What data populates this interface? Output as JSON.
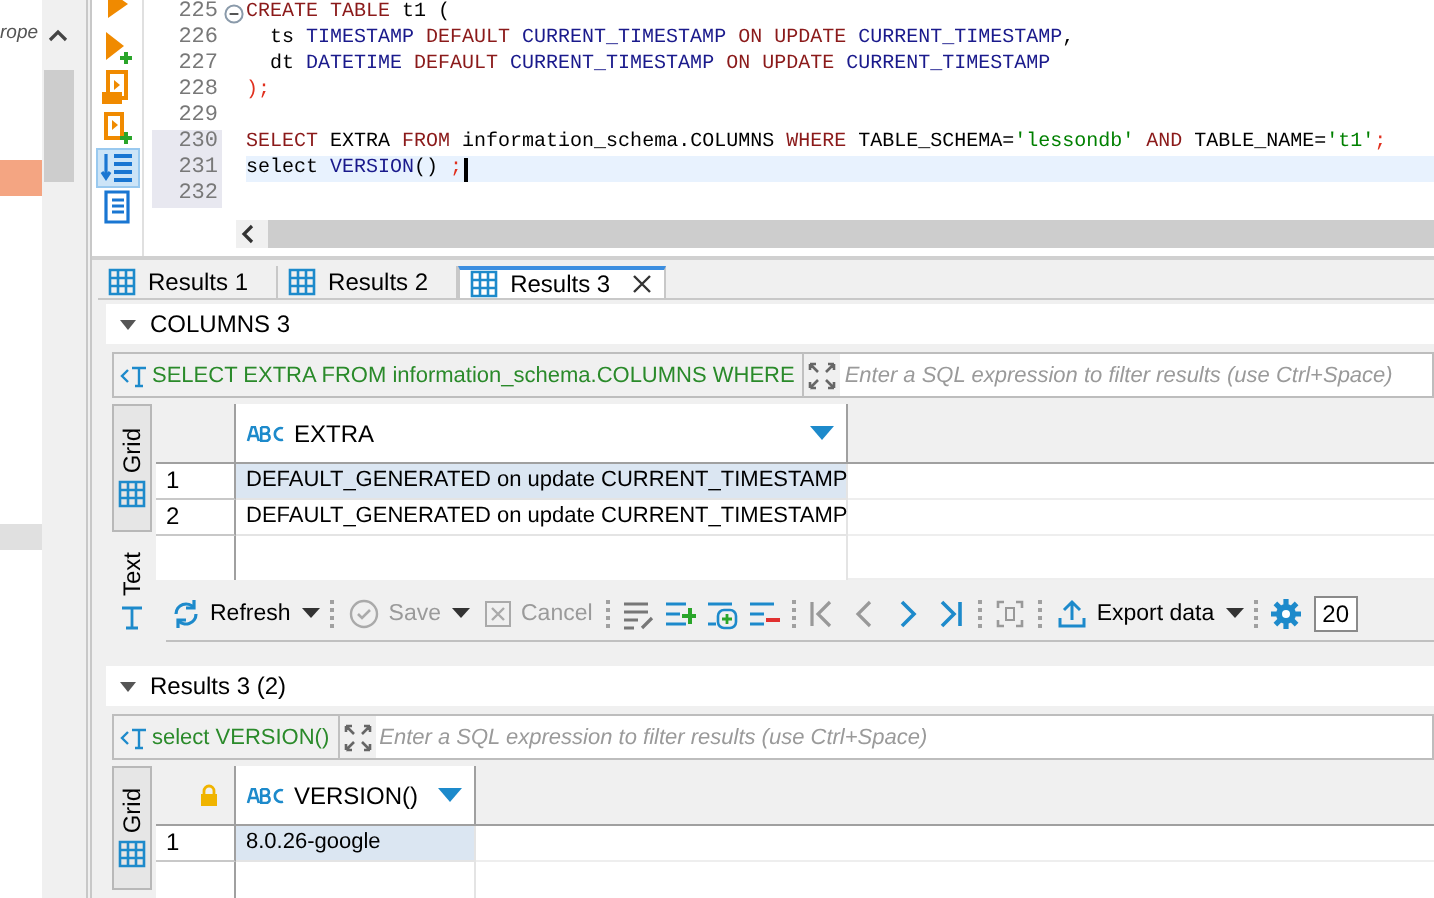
{
  "left_panel": {
    "label": "rope"
  },
  "editor": {
    "tools": [
      {
        "selected": false
      },
      {
        "selected": false
      },
      {
        "selected": false
      },
      {
        "selected": false
      },
      {
        "selected": true
      },
      {
        "selected": false
      }
    ],
    "lines": [
      {
        "number": "225",
        "collapsible": true,
        "marked": false,
        "current": false,
        "tokens": [
          {
            "kind": "keyword",
            "text": "CREATE TABLE"
          },
          {
            "kind": "plain",
            "text": " t1 ("
          }
        ]
      },
      {
        "number": "226",
        "collapsible": false,
        "marked": false,
        "current": false,
        "tokens": [
          {
            "kind": "plain",
            "text": "  ts "
          },
          {
            "kind": "type",
            "text": "TIMESTAMP "
          },
          {
            "kind": "keyword",
            "text": "DEFAULT "
          },
          {
            "kind": "type",
            "text": "CURRENT_TIMESTAMP "
          },
          {
            "kind": "keyword",
            "text": "ON UPDATE "
          },
          {
            "kind": "type",
            "text": "CURRENT_TIMESTAMP"
          },
          {
            "kind": "plain",
            "text": ","
          }
        ]
      },
      {
        "number": "227",
        "collapsible": false,
        "marked": false,
        "current": false,
        "tokens": [
          {
            "kind": "plain",
            "text": "  dt "
          },
          {
            "kind": "type",
            "text": "DATETIME "
          },
          {
            "kind": "keyword",
            "text": "DEFAULT "
          },
          {
            "kind": "type",
            "text": "CURRENT_TIMESTAMP "
          },
          {
            "kind": "keyword",
            "text": "ON UPDATE "
          },
          {
            "kind": "type",
            "text": "CURRENT_TIMESTAMP"
          }
        ]
      },
      {
        "number": "228",
        "collapsible": false,
        "marked": false,
        "current": false,
        "tokens": [
          {
            "kind": "punct",
            "text": ");"
          }
        ]
      },
      {
        "number": "229",
        "collapsible": false,
        "marked": false,
        "current": false
      },
      {
        "number": "230",
        "collapsible": false,
        "marked": true,
        "current": false,
        "tokens": [
          {
            "kind": "keyword",
            "text": "SELECT"
          },
          {
            "kind": "plain",
            "text": " EXTRA "
          },
          {
            "kind": "keyword",
            "text": "FROM"
          },
          {
            "kind": "plain",
            "text": " information_schema.COLUMNS "
          },
          {
            "kind": "keyword",
            "text": "WHERE"
          },
          {
            "kind": "plain",
            "text": " TABLE_SCHEMA="
          },
          {
            "kind": "string",
            "text": "'lessondb' "
          },
          {
            "kind": "keyword",
            "text": "AND"
          },
          {
            "kind": "plain",
            "text": " TABLE_NAME="
          },
          {
            "kind": "string",
            "text": "'t1'"
          },
          {
            "kind": "punct",
            "text": ";"
          }
        ]
      },
      {
        "number": "231",
        "collapsible": false,
        "marked": true,
        "current": true,
        "tokens": [
          {
            "kind": "plain",
            "text": "select "
          },
          {
            "kind": "type",
            "text": "VERSION"
          },
          {
            "kind": "plain",
            "text": "() "
          },
          {
            "kind": "punct",
            "text": ";"
          }
        ]
      },
      {
        "number": "232",
        "collapsible": false,
        "marked": true,
        "current": false
      }
    ]
  },
  "result_tabs": [
    {
      "label": "Results 1",
      "selected": false,
      "closable": false
    },
    {
      "label": "Results 2",
      "selected": false,
      "closable": false
    },
    {
      "label": "Results 3",
      "selected": true,
      "closable": true
    }
  ],
  "results": [
    {
      "title": "COLUMNS 3",
      "expanded": true,
      "query": "SELECT EXTRA FROM information_schema.COLUMNS WHERE",
      "filter_placeholder": "Enter a SQL expression to filter results (use Ctrl+Space)",
      "views": [
        {
          "label": "Grid",
          "selected": true
        },
        {
          "label": "Text",
          "selected": false
        }
      ],
      "locked": false,
      "columns": [
        "EXTRA"
      ],
      "rows": [
        {
          "number": "1",
          "cells": [
            "DEFAULT_GENERATED on update CURRENT_TIMESTAMP"
          ],
          "selected": true
        },
        {
          "number": "2",
          "cells": [
            "DEFAULT_GENERATED on update CURRENT_TIMESTAMP"
          ],
          "selected": false
        }
      ],
      "toolbar": {
        "refresh": {
          "label": "Refresh",
          "disabled": false
        },
        "save": {
          "label": "Save",
          "disabled": true
        },
        "cancel": {
          "label": "Cancel",
          "disabled": true
        },
        "nav": [
          {
            "disabled": true
          },
          {
            "disabled": true
          },
          {
            "disabled": false
          },
          {
            "disabled": false
          }
        ],
        "export": {
          "label": "Export data",
          "disabled": false
        },
        "fetch_size": "20"
      }
    },
    {
      "title": "Results 3 (2)",
      "expanded": true,
      "query": "select VERSION()",
      "filter_placeholder": "Enter a SQL expression to filter results (use Ctrl+Space)",
      "views": [
        {
          "label": "Grid",
          "selected": true
        }
      ],
      "locked": true,
      "columns": [
        "VERSION()"
      ],
      "rows": [
        {
          "number": "1",
          "cells": [
            "8.0.26-google"
          ],
          "selected": true
        }
      ]
    }
  ]
}
